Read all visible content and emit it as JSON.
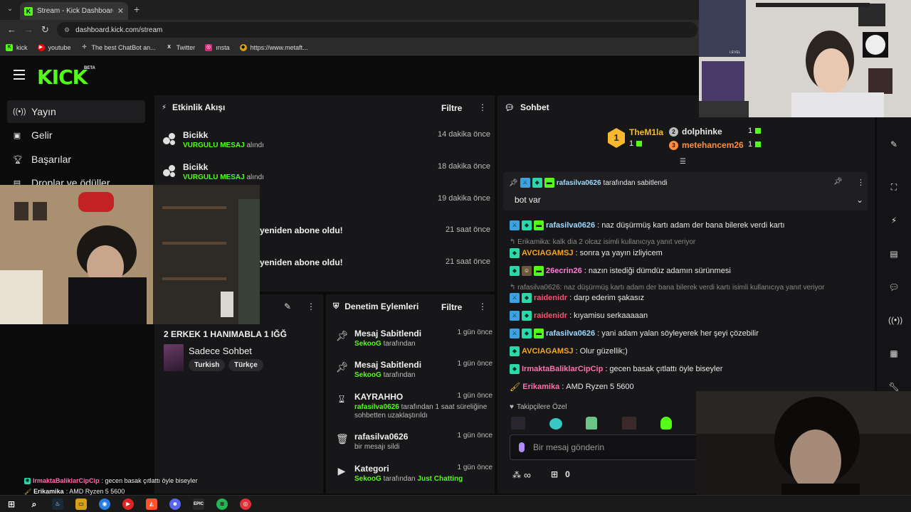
{
  "browser": {
    "tab_title": "Stream - Kick Dashboard",
    "new_tab": "+",
    "url": "dashboard.kick.com/stream",
    "bookmarks": [
      "kick",
      "youtube",
      "The best ChatBot an...",
      "Twitter",
      "ınsta",
      "https://www.metaft..."
    ]
  },
  "kick": {
    "logo": "KICK",
    "beta": "BETA"
  },
  "sidebar": {
    "items": [
      {
        "label": "Yayın"
      },
      {
        "label": "Gelir"
      },
      {
        "label": "Başarılar"
      },
      {
        "label": "Droplar ve ödüller"
      }
    ]
  },
  "activity": {
    "title": "Etkinlik Akışı",
    "filter": "Filtre",
    "items": [
      {
        "name": "Bicikk",
        "highlight": "VURGULU MESAJ",
        "rest": "alındı",
        "time": "14 dakika önce"
      },
      {
        "name": "Bicikk",
        "highlight": "VURGULU MESAJ",
        "rest": "alındı",
        "time": "18 dakika önce"
      },
      {
        "name": "",
        "highlight": "",
        "rest": "",
        "time": "19 dakika önce"
      },
      {
        "name": "yeniden abone oldu!",
        "highlight": "",
        "rest": "",
        "time": "21 saat önce"
      },
      {
        "name": "yeniden abone oldu!",
        "highlight": "",
        "rest": "",
        "time": "21 saat önce"
      }
    ]
  },
  "stream_info": {
    "title": "2 ERKEK 1 HANIMABLA 1 IĞĞ",
    "category": "Sadece Sohbet",
    "tags": [
      "Turkish",
      "Türkçe"
    ]
  },
  "moderation": {
    "title": "Denetim Eylemleri",
    "filter": "Filtre",
    "items": [
      {
        "icon": "pin",
        "name": "Mesaj Sabitlendi",
        "actor": "SekooG",
        "text": "tarafından",
        "extra": "",
        "time": "1 gün önce"
      },
      {
        "icon": "pin",
        "name": "Mesaj Sabitlendi",
        "actor": "SekooG",
        "text": "tarafından",
        "extra": "",
        "time": "1 gün önce"
      },
      {
        "icon": "hourglass",
        "name": "KAYRAHHO",
        "actor": "rafasilva0626",
        "text": "tarafından 1 saat süreliğine sohbetten uzaklaştırıldı",
        "extra": "",
        "time": "1 gün önce"
      },
      {
        "icon": "trash",
        "name": "rafasilva0626",
        "actor": "",
        "text": "bir mesajı sildi",
        "extra": "",
        "time": "1 gün önce"
      },
      {
        "icon": "category",
        "name": "Kategori",
        "actor": "SekooG",
        "text": "tarafından",
        "extra": "Just Chatting",
        "time": "1 gün önce"
      }
    ]
  },
  "chat": {
    "title": "Sohbet",
    "leaderboard": [
      {
        "rank": "1",
        "name": "TheM1la",
        "count": "1",
        "color": "#f5b82e"
      },
      {
        "rank": "2",
        "name": "dolphinke",
        "count": "1",
        "color": "#e8e8e8"
      },
      {
        "rank": "3",
        "name": "metehancem26",
        "count": "1",
        "color": "#ff8c3a"
      }
    ],
    "pinned": {
      "by": "rafasilva0626",
      "by_text": "tarafından sabitlendi",
      "message": "bot var"
    },
    "messages": [
      {
        "type": "msg",
        "badges": [
          "mod",
          "vip",
          "sub"
        ],
        "user": "rafasilva0626",
        "color": "#9ed9ff",
        "text": "naz düşürmüş kartı adam der bana bilerek verdi kartı"
      },
      {
        "type": "reply",
        "text": "Erikamika: kalk dia 2 olcaz isimli kullanıcıya yanıt veriyor"
      },
      {
        "type": "msg",
        "badges": [
          "vip"
        ],
        "user": "AVCIAGAMSJ",
        "color": "#f5a623",
        "text": "sonra ya yayın izliyicem"
      },
      {
        "type": "msg",
        "badges": [
          "vip",
          "og",
          "sub"
        ],
        "user": "26ecrin26",
        "color": "#ff7ad9",
        "text": "nazın istediği dümdüz adamın sürünmesi"
      },
      {
        "type": "reply",
        "text": "rafasilva0626: naz düşürmüş kartı adam der bana bilerek verdi kartı isimli kullanıcıya yanıt veriyor"
      },
      {
        "type": "msg",
        "badges": [
          "mod",
          "vip"
        ],
        "user": "raidenidr",
        "color": "#ff4f6e",
        "text": "darp ederim şakasız"
      },
      {
        "type": "msg",
        "badges": [
          "mod",
          "vip"
        ],
        "user": "raidenidr",
        "color": "#ff4f6e",
        "text": "kıyamisu serkaaaaan"
      },
      {
        "type": "msg",
        "badges": [
          "mod",
          "vip",
          "sub"
        ],
        "user": "rafasilva0626",
        "color": "#9ed9ff",
        "text": "yani adam yalan söyleyerek her şeyi çözebilir"
      },
      {
        "type": "msg",
        "badges": [
          "vip"
        ],
        "user": "AVCIAGAMSJ",
        "color": "#f5a623",
        "text": "Olur güzellik;)"
      },
      {
        "type": "msg",
        "badges": [
          "vip"
        ],
        "user": "IrmaktaBaliklarCipCip",
        "color": "#ff6fae",
        "text": "gecen basak çıtlattı öyle biseyler"
      },
      {
        "type": "msg",
        "badges": [
          "brush"
        ],
        "user": "Erikamika",
        "color": "#ff6fae",
        "text": "AMD Ryzen 5 5600"
      }
    ],
    "followers_only": "Takipçilere Özel",
    "input_placeholder": "Bir mesaj gönderin",
    "points_value": "∞",
    "gift_count": "0"
  },
  "overlay_chat": [
    {
      "user": "IrmaktaBaliklarCipCip",
      "text": ": gecen basak çıtlattı öyle biseyler",
      "color": "#ff6fae"
    },
    {
      "user": "Erikamika",
      "text": ": AMD Ryzen 5 5600",
      "color": "#ffffff"
    }
  ],
  "cam_overlays": {
    "level_text": "LEVEL"
  },
  "taskbar": {
    "epic": "EPIC"
  },
  "colors": {
    "accent": "#53fc18",
    "panel": "#171719",
    "background": "#0b0b0c"
  }
}
